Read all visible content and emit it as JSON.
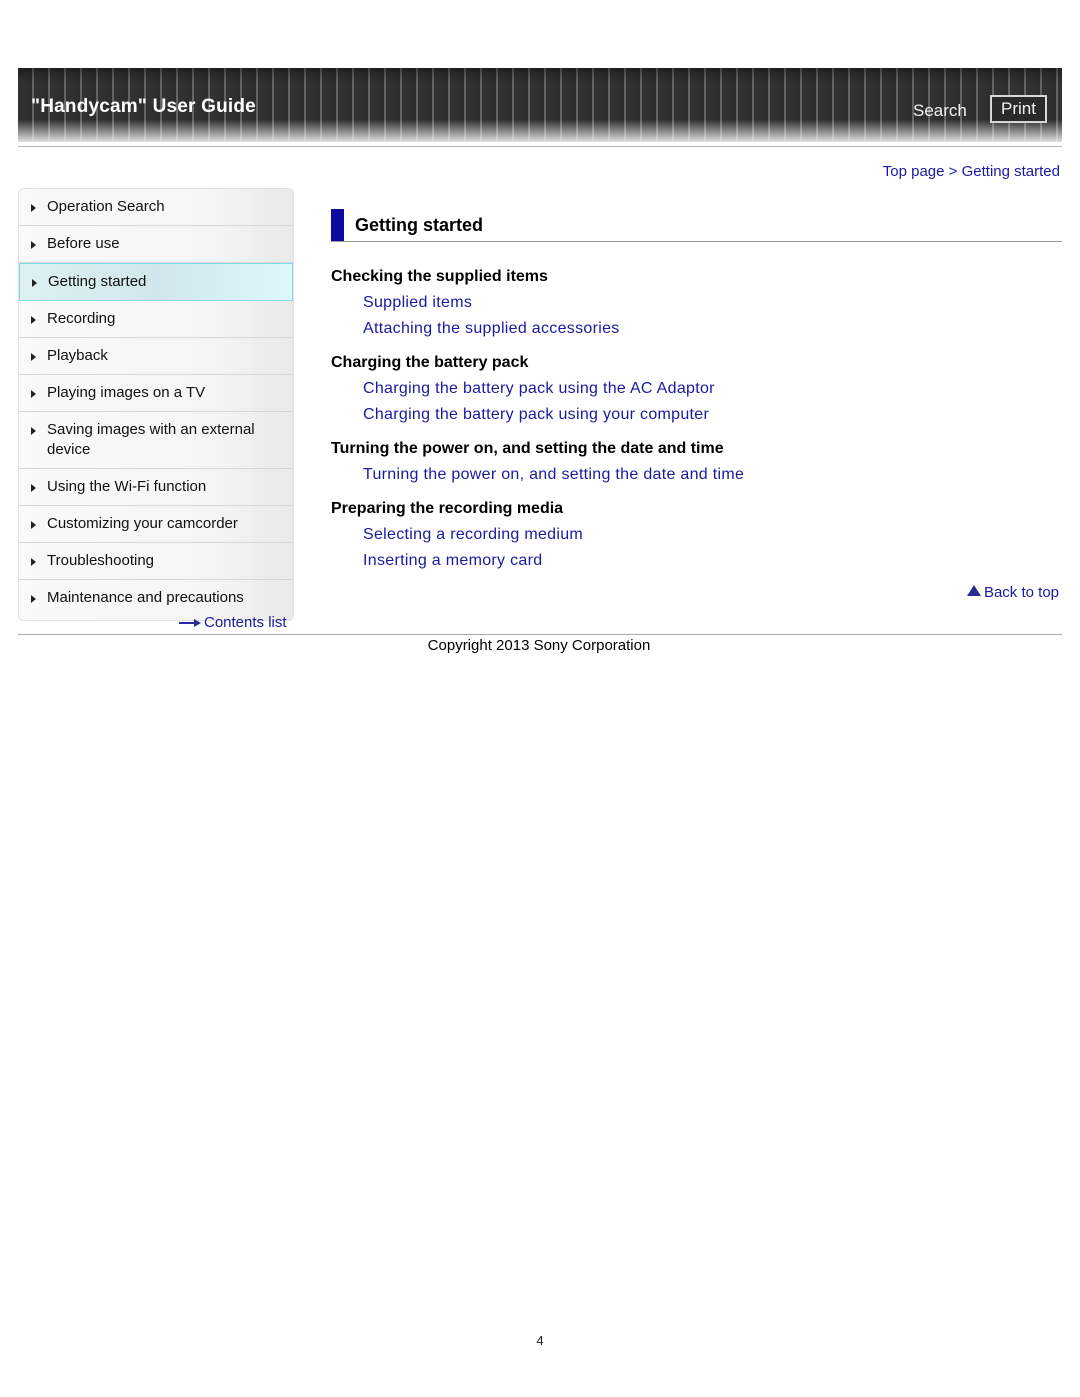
{
  "header": {
    "title": "\"Handycam\" User Guide",
    "search_label": "Search",
    "print_label": "Print"
  },
  "breadcrumb": {
    "items": [
      "Top page",
      "Getting started"
    ],
    "separator": ">"
  },
  "sidebar": {
    "items": [
      {
        "label": "Operation Search",
        "active": false
      },
      {
        "label": "Before use",
        "active": false
      },
      {
        "label": "Getting started",
        "active": true
      },
      {
        "label": "Recording",
        "active": false
      },
      {
        "label": "Playback",
        "active": false
      },
      {
        "label": "Playing images on a TV",
        "active": false
      },
      {
        "label": "Saving images with an external device",
        "active": false
      },
      {
        "label": "Using the Wi-Fi function",
        "active": false
      },
      {
        "label": "Customizing your camcorder",
        "active": false
      },
      {
        "label": "Troubleshooting",
        "active": false
      },
      {
        "label": "Maintenance and precautions",
        "active": false
      }
    ],
    "contents_link": "Contents list"
  },
  "main": {
    "heading": "Getting started",
    "sections": [
      {
        "title": "Checking the supplied items",
        "links": [
          "Supplied items",
          "Attaching the supplied accessories"
        ]
      },
      {
        "title": "Charging the battery pack",
        "links": [
          "Charging the battery pack using the AC Adaptor",
          "Charging the battery pack using your computer"
        ]
      },
      {
        "title": "Turning the power on, and setting the date and time",
        "links": [
          "Turning the power on, and setting the date and time"
        ]
      },
      {
        "title": "Preparing the recording media",
        "links": [
          "Selecting a recording medium",
          "Inserting a memory card"
        ]
      }
    ],
    "back_to_top": "Back to top"
  },
  "footer": {
    "copyright": "Copyright 2013 Sony Corporation",
    "page_number": "4"
  },
  "colors": {
    "link": "#1a1aa0",
    "heading_bar": "#0a0aa0",
    "active_nav_border": "#80dce8"
  }
}
